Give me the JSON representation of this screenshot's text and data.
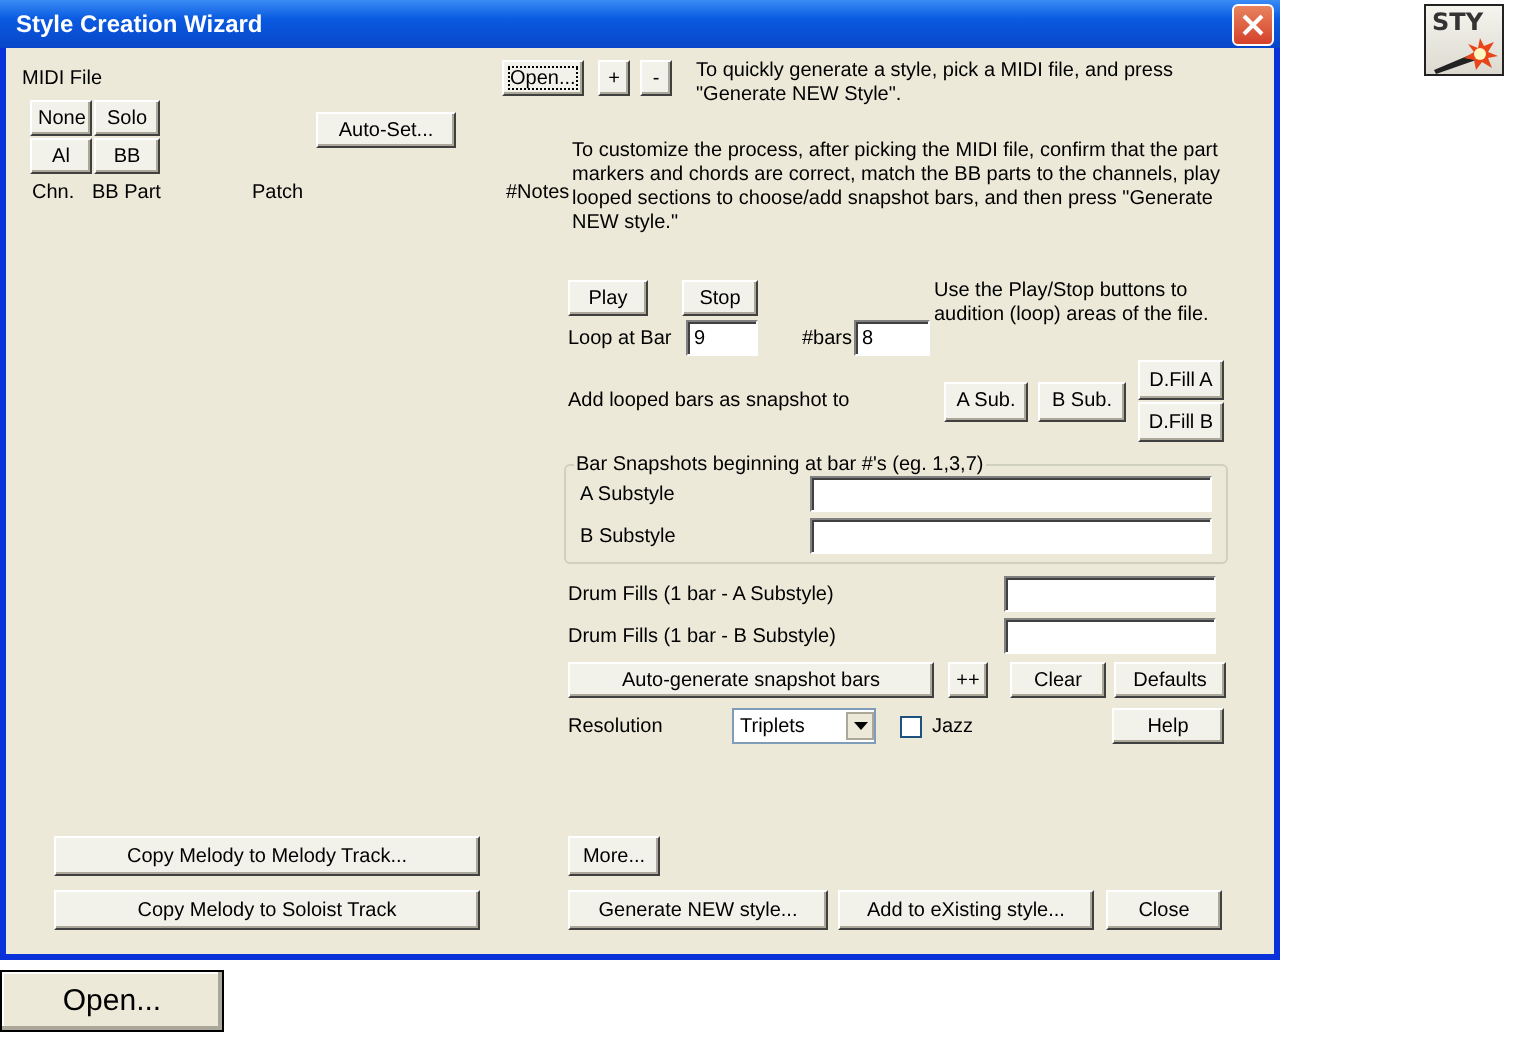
{
  "window": {
    "title": "Style Creation Wizard"
  },
  "midi_file": {
    "label": "MIDI File",
    "buttons": [
      "None",
      "Solo",
      "Al",
      "BB"
    ],
    "auto_set": "Auto-Set..."
  },
  "columns": [
    "Chn.",
    "BB Part",
    "Patch",
    "#Notes"
  ],
  "file_buttons": [
    {
      "label": "Open...",
      "focused": true
    },
    {
      "label": "+",
      "focused": false
    },
    {
      "label": "-",
      "focused": false
    }
  ],
  "quick_hint": "To quickly generate a style, pick a MIDI file, and press \"Generate NEW Style\".",
  "customize_hint": "To customize the process, after picking the MIDI file, confirm that the part markers and chords are correct, match the BB parts to the channels, play looped sections to choose/add snapshot bars, and then press \"Generate NEW style.\"",
  "playback": {
    "play": "Play",
    "stop": "Stop",
    "hint": "Use the Play/Stop buttons to audition (loop) areas of the file.",
    "loop_label": "Loop at Bar",
    "loop_value": "9",
    "bars_label": "#bars",
    "bars_value": "8"
  },
  "snapshot": {
    "label": "Add looped bars as snapshot to",
    "buttons": [
      "A Sub.",
      "B Sub."
    ],
    "fill_buttons": [
      "D.Fill A",
      "D.Fill B"
    ]
  },
  "bar_snapshots": {
    "legend": "Bar Snapshots beginning at bar #'s (eg. 1,3,7)",
    "fields": [
      {
        "label": "A Substyle"
      },
      {
        "label": "B Substyle"
      }
    ]
  },
  "drum_fills": [
    {
      "label": "Drum Fills (1 bar - A Substyle)"
    },
    {
      "label": "Drum Fills (1 bar - B Substyle)"
    }
  ],
  "action_buttons": [
    "Auto-generate snapshot bars",
    "++",
    "Clear",
    "Defaults"
  ],
  "resolution": {
    "label": "Resolution",
    "value": "Triplets"
  },
  "jazz": {
    "label": "Jazz",
    "checked": false
  },
  "help": "Help",
  "copy_buttons": [
    "Copy Melody to Melody Track...",
    "Copy Melody to Soloist Track"
  ],
  "more": "More...",
  "footer_buttons": [
    "Generate NEW style...",
    "Add to eXisting style...",
    "Close"
  ],
  "toolbar_icon": {
    "text": "STY"
  },
  "open_button_sample": "Open..."
}
